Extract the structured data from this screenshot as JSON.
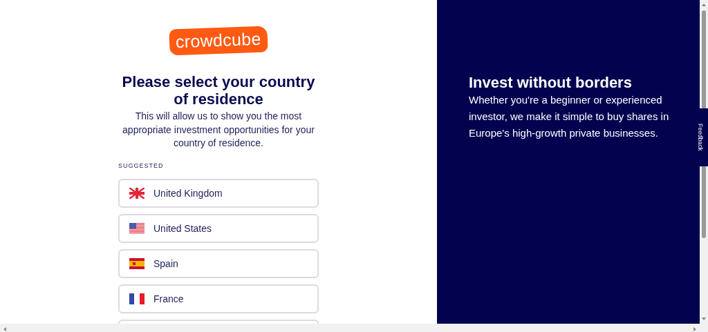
{
  "logo": {
    "text": "crowdcube"
  },
  "heading": "Please select your country of residence",
  "intro": "This will allow us to show you the most appropriate investment opportunities for your country of residence.",
  "section_label": "SUGGESTED",
  "countries": [
    {
      "name": "United Kingdom",
      "kind": "uk"
    },
    {
      "name": "United States",
      "kind": "us"
    },
    {
      "name": "Spain",
      "kind": "es"
    },
    {
      "name": "France",
      "kind": "fr"
    },
    {
      "kind": "cut"
    }
  ],
  "promo": {
    "title": "Invest without borders",
    "text": "Whether you're a beginner or experienced investor, we make it simple to buy shares in Europe's high-growth private businesses."
  },
  "feedback_tab": "Feedback"
}
